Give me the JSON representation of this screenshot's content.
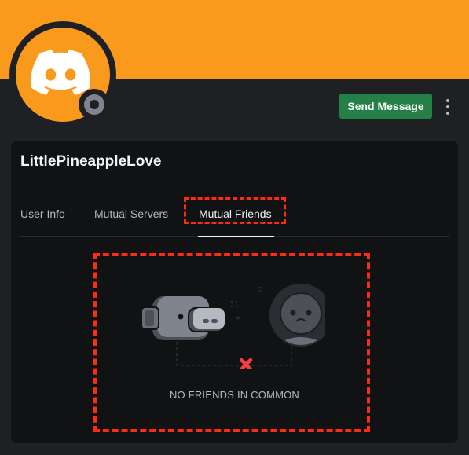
{
  "profile": {
    "username": "LittlePineappleLove",
    "status": "offline",
    "colors": {
      "banner": "#fa9a1d",
      "avatar_bg": "#fa9a1d",
      "send_button": "#248046",
      "highlight": "#fd2b12"
    },
    "avatar_icon": "discord-logo-icon",
    "status_icon": "offline-status-icon"
  },
  "actions": {
    "send_message_label": "Send Message",
    "more_icon": "more-vertical-icon"
  },
  "tabs": [
    {
      "label": "User Info",
      "active": false
    },
    {
      "label": "Mutual Servers",
      "active": false
    },
    {
      "label": "Mutual Friends",
      "active": true
    }
  ],
  "empty_state": {
    "text": "NO FRIENDS IN COMMON",
    "illustration": "no-mutual-friends-illustration",
    "x_icon": "red-x-icon"
  }
}
